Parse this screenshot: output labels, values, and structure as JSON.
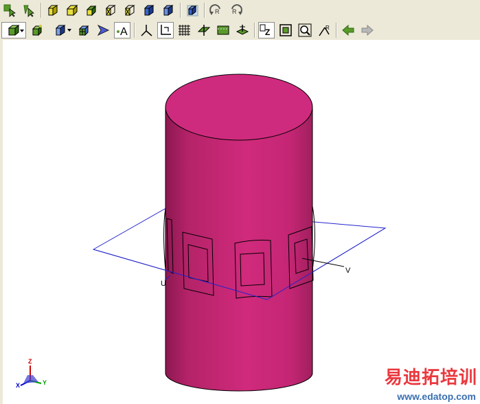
{
  "toolbar": {
    "row1": [
      {
        "name": "select-vertex-icon"
      },
      {
        "name": "select-edge-icon"
      },
      {
        "sep": true
      },
      {
        "name": "box-yellow-icon"
      },
      {
        "name": "box-yellow-flat-icon"
      },
      {
        "name": "box-yellow-half-icon"
      },
      {
        "name": "box-wire-yellow-icon"
      },
      {
        "name": "box-wire-yellow-2-icon"
      },
      {
        "name": "box-wire-blue-icon"
      },
      {
        "name": "box-wire-blue-2-icon"
      },
      {
        "sep": true
      },
      {
        "name": "box-wire-grey-icon"
      },
      {
        "sep": true
      },
      {
        "name": "rotate-left-icon"
      },
      {
        "name": "rotate-right-icon"
      }
    ],
    "row2": [
      {
        "name": "shaded-view-dropdown-icon",
        "wide": true,
        "pressed": true
      },
      {
        "name": "solid-box-icon"
      },
      {
        "name": "wire-box-dropdown-icon",
        "wide": true
      },
      {
        "name": "mesh-box-icon"
      },
      {
        "name": "arrow-select-icon"
      },
      {
        "name": "text-annotation-icon",
        "pressed": true
      },
      {
        "sep": true
      },
      {
        "name": "axes-icon"
      },
      {
        "name": "corner-icon",
        "pressed": true
      },
      {
        "name": "grid-icon"
      },
      {
        "name": "plane-icon"
      },
      {
        "name": "rect-face-icon"
      },
      {
        "name": "tree-icon"
      },
      {
        "sep": true
      },
      {
        "name": "zoom-z-icon",
        "pressed": true
      },
      {
        "name": "fit-all-icon"
      },
      {
        "name": "zoom-icon"
      },
      {
        "name": "pick-r-icon"
      },
      {
        "sep": true
      },
      {
        "name": "back-arrow-icon"
      },
      {
        "name": "forward-arrow-icon"
      }
    ]
  },
  "viewport": {
    "axis_u": "U",
    "axis_v": "V",
    "triad": {
      "x": "X",
      "y": "Y",
      "z": "Z"
    },
    "colors": {
      "cylinder": "#cc2a78",
      "cylinder_dark": "#9c1e5a",
      "plane": "#2222cc",
      "background": "#ffffff"
    }
  },
  "watermark": {
    "title": "易迪拓培训",
    "url": "www.edatop.com"
  }
}
